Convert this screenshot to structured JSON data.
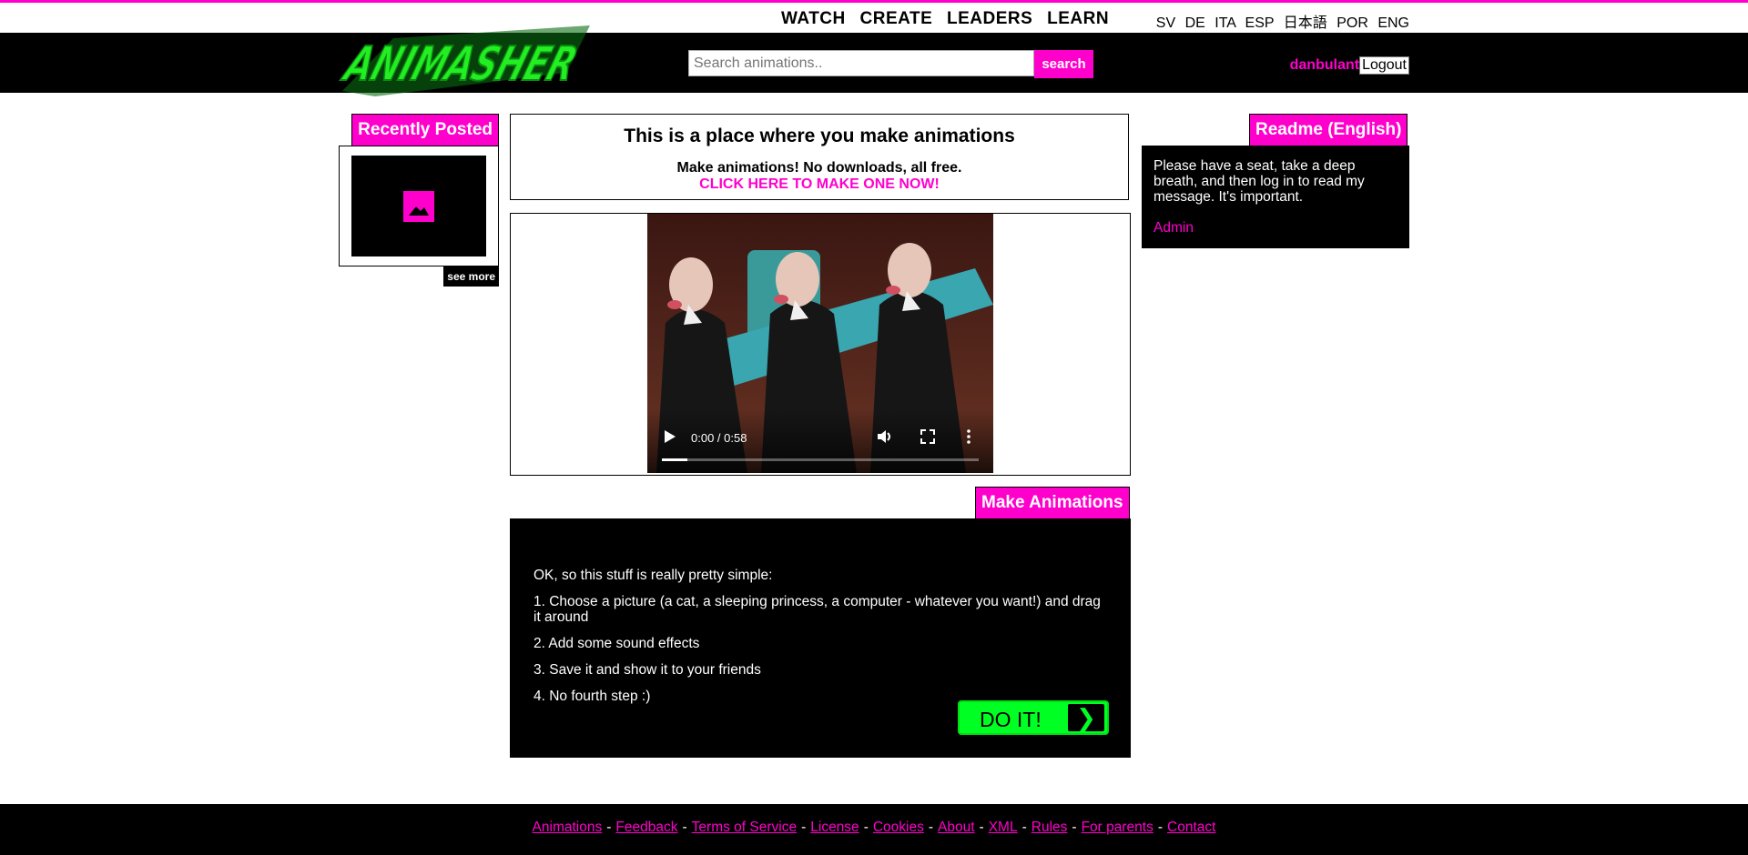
{
  "topnav": [
    "WATCH",
    "CREATE",
    "LEADERS",
    "LEARN"
  ],
  "languages": [
    "SV",
    "DE",
    "ITA",
    "ESP",
    "日本語",
    "POR",
    "ENG"
  ],
  "logo_text": "ANIMASHER",
  "search": {
    "placeholder": "Search animations..",
    "button": "search"
  },
  "user": {
    "name": "danbulant",
    "logout": "Logout"
  },
  "recent": {
    "title": "Recently Posted",
    "see_more": "see more"
  },
  "intro": {
    "title": "This is a place where you make animations",
    "subtitle": "Make animations! No downloads, all free.",
    "cta": "CLICK HERE TO MAKE ONE NOW!"
  },
  "video": {
    "time": "0:00 / 0:58",
    "progress": 0.08
  },
  "make": {
    "title": "Make Animations",
    "lines": [
      "OK, so this stuff is really pretty simple:",
      "1. Choose a picture (a cat, a sleeping princess, a computer - whatever you want!) and drag it around",
      "2. Add some sound effects",
      "3. Save it and show it to your friends",
      "4. No fourth step :)"
    ],
    "button": "DO IT!",
    "button_arrow": "❯"
  },
  "readme": {
    "title": "Readme (English)",
    "text": "Please have a seat, take a deep breath, and then log in to read my message. It's important.",
    "author": "Admin"
  },
  "footer": {
    "links": [
      "Animations",
      "Feedback",
      "Terms of Service",
      "License",
      "Cookies",
      "About",
      "XML",
      "Rules",
      "For parents",
      "Contact"
    ]
  },
  "colors": {
    "accent": "#ff00cc",
    "green": "#00ff22",
    "dark": "#000000"
  }
}
